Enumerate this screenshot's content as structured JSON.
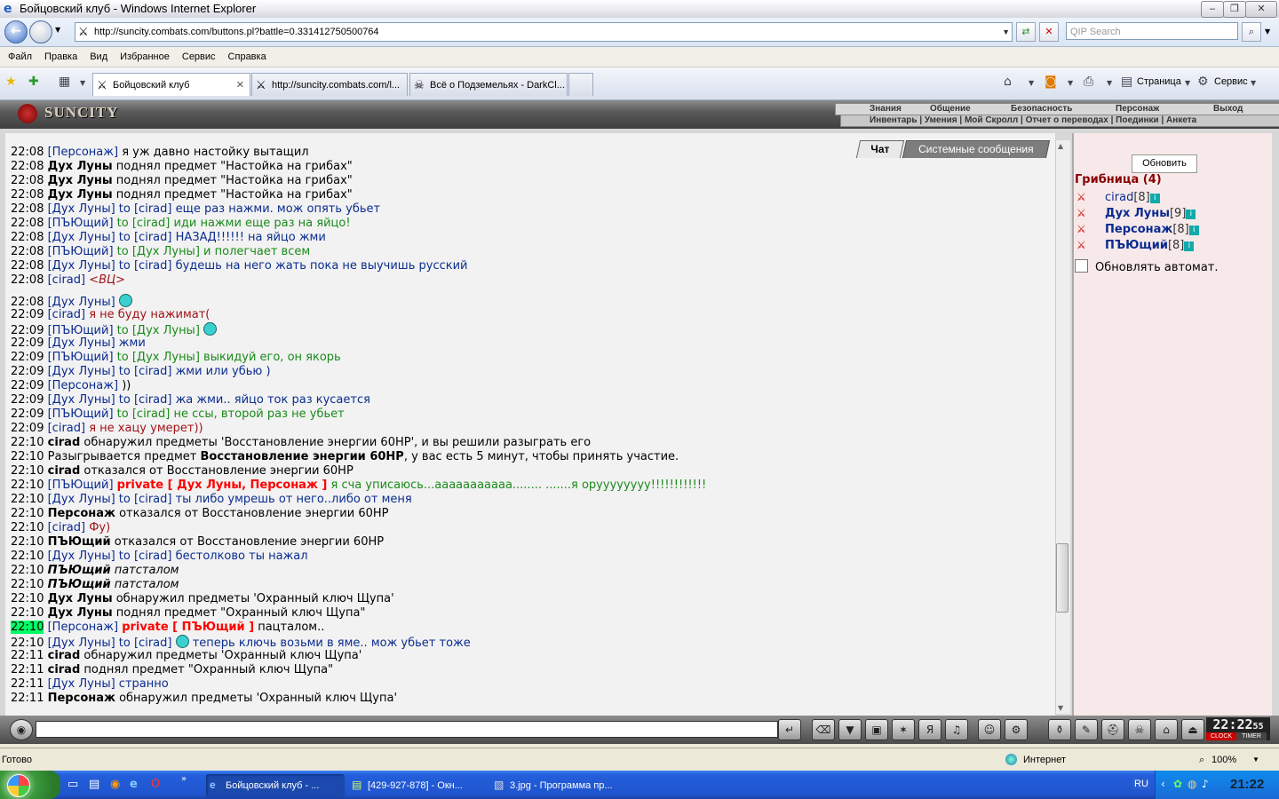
{
  "window": {
    "title": "Бойцовский клуб - Windows Internet Explorer",
    "url": "http://suncity.combats.com/buttons.pl?battle=0.331412750500764",
    "search_placeholder": "QIP Search"
  },
  "menu": [
    "Файл",
    "Правка",
    "Вид",
    "Избранное",
    "Сервис",
    "Справка"
  ],
  "tabs": [
    {
      "label": "Бойцовский клуб",
      "close": "✕"
    },
    {
      "label": "http://suncity.combats.com/l..."
    },
    {
      "label": "Всё о Подземельях - DarkCl..."
    }
  ],
  "toolbar": {
    "page_label": "Страница",
    "tools_label": "Сервис"
  },
  "game": {
    "logo": "SUNCITY",
    "nav_top": [
      "Знания",
      "Общение",
      "Безопасность",
      "Персонаж",
      "Выход"
    ],
    "nav_bottom": "Инвентарь | Умения | Мой Скролл | Отчет о переводах | Поединки | Анкета",
    "chat_tab": "Чат",
    "system_tab": "Системные сообщения",
    "refresh_btn": "Обновить",
    "location": "Грибница (4)",
    "players": [
      {
        "name": "cirad",
        "level": "[8]",
        "bold": false
      },
      {
        "name": "Дух Луны",
        "level": "[9]",
        "bold": true
      },
      {
        "name": "Персонаж",
        "level": "[8]",
        "bold": true
      },
      {
        "name": "ПЪЮщий",
        "level": "[8]",
        "bold": true
      }
    ],
    "auto_refresh": "Обновлять автомат.",
    "clock": "22:22",
    "clock_sec": "55",
    "clock_label": "CLOCK",
    "timer_label": "TIMER"
  },
  "chat": [
    {
      "t": "22:08",
      "parts": [
        [
          "b",
          "[Персонаж]"
        ],
        [
          "n",
          " я уж давно настойку вытащил"
        ]
      ]
    },
    {
      "t": "22:08",
      "parts": [
        [
          "k",
          "Дух Луны"
        ],
        [
          "n",
          " поднял предмет \"Настойка на грибах\""
        ]
      ]
    },
    {
      "t": "22:08",
      "parts": [
        [
          "k",
          "Дух Луны"
        ],
        [
          "n",
          " поднял предмет \"Настойка на грибах\""
        ]
      ]
    },
    {
      "t": "22:08",
      "parts": [
        [
          "k",
          "Дух Луны"
        ],
        [
          "n",
          " поднял предмет \"Настойка на грибах\""
        ]
      ]
    },
    {
      "t": "22:08",
      "parts": [
        [
          "b",
          "[Дух Луны]"
        ],
        [
          "u",
          " to [cirad] еще раз нажми. мож опять убьет"
        ]
      ]
    },
    {
      "t": "22:08",
      "parts": [
        [
          "b",
          "[ПЪЮщий]"
        ],
        [
          "g",
          " to [cirad] иди нажми еще раз на яйцо!"
        ]
      ]
    },
    {
      "t": "22:08",
      "parts": [
        [
          "b",
          "[Дух Луны]"
        ],
        [
          "u",
          " to [cirad] НАЗАД!!!!!! на яйцо жми"
        ]
      ]
    },
    {
      "t": "22:08",
      "parts": [
        [
          "b",
          "[ПЪЮщий]"
        ],
        [
          "g",
          " to [Дух Луны] и полегчает всем"
        ]
      ]
    },
    {
      "t": "22:08",
      "parts": [
        [
          "b",
          "[Дух Луны]"
        ],
        [
          "u",
          " to [cirad] будешь на него жать пока не выучишь русский"
        ]
      ]
    },
    {
      "t": "22:08",
      "parts": [
        [
          "b",
          "[cirad]"
        ],
        [
          "ri",
          " <ВЦ>"
        ]
      ]
    },
    {
      "t": "22:08",
      "parts": [
        [
          "b",
          "[Дух Луны]"
        ],
        [
          "n",
          " "
        ],
        [
          "emo",
          ""
        ]
      ]
    },
    {
      "t": "22:09",
      "parts": [
        [
          "b",
          "[cirad]"
        ],
        [
          "r",
          " я не буду нажимат("
        ]
      ]
    },
    {
      "t": "22:09",
      "parts": [
        [
          "b",
          "[ПЪЮщий]"
        ],
        [
          "g",
          " to [Дух Луны] "
        ],
        [
          "emo",
          ""
        ]
      ]
    },
    {
      "t": "22:09",
      "parts": [
        [
          "b",
          "[Дух Луны]"
        ],
        [
          "u",
          " жми"
        ]
      ]
    },
    {
      "t": "22:09",
      "parts": [
        [
          "b",
          "[ПЪЮщий]"
        ],
        [
          "g",
          " to [Дух Луны] выкидуй его, он якорь"
        ]
      ]
    },
    {
      "t": "22:09",
      "parts": [
        [
          "b",
          "[Дух Луны]"
        ],
        [
          "u",
          " to [cirad] жми или убью )"
        ]
      ]
    },
    {
      "t": "22:09",
      "parts": [
        [
          "b",
          "[Персонаж]"
        ],
        [
          "n",
          " ))"
        ]
      ]
    },
    {
      "t": "22:09",
      "parts": [
        [
          "b",
          "[Дух Луны]"
        ],
        [
          "u",
          " to [cirad] жа жми.. яйцо ток раз кусается"
        ]
      ]
    },
    {
      "t": "22:09",
      "parts": [
        [
          "b",
          "[ПЪЮщий]"
        ],
        [
          "g",
          " to [cirad] не ссы, второй раз не убьет"
        ]
      ]
    },
    {
      "t": "22:09",
      "parts": [
        [
          "b",
          "[cirad]"
        ],
        [
          "r",
          " я не хацу умерет))"
        ]
      ]
    },
    {
      "t": "22:10",
      "parts": [
        [
          "k",
          "cirad"
        ],
        [
          "n",
          " обнаружил предметы 'Восстановление энергии 60HP', и вы решили разыграть его"
        ]
      ]
    },
    {
      "t": "22:10",
      "parts": [
        [
          "n",
          "Разыгрывается предмет "
        ],
        [
          "k",
          "Восстановление энергии 60HP"
        ],
        [
          "n",
          ", у вас есть 5 минут, чтобы принять участие."
        ]
      ]
    },
    {
      "t": "22:10",
      "parts": [
        [
          "k",
          "cirad"
        ],
        [
          "n",
          " отказался от Восстановление энергии 60HP"
        ]
      ]
    },
    {
      "t": "22:10",
      "parts": [
        [
          "b",
          "[ПЪЮщий]"
        ],
        [
          "n",
          " "
        ],
        [
          "p",
          "private [ Дух Луны, Персонаж ]"
        ],
        [
          "g",
          " я сча уписаюсь...ааааааааааа........ .......я оруууууууу!!!!!!!!!!!!"
        ]
      ]
    },
    {
      "t": "22:10",
      "parts": [
        [
          "b",
          "[Дух Луны]"
        ],
        [
          "u",
          " to [cirad] ты либо умрешь от него..либо от меня"
        ]
      ]
    },
    {
      "t": "22:10",
      "parts": [
        [
          "k",
          "Персонаж"
        ],
        [
          "n",
          " отказался от Восстановление энергии 60HP"
        ]
      ]
    },
    {
      "t": "22:10",
      "parts": [
        [
          "b",
          "[cirad]"
        ],
        [
          "r",
          " Фу)"
        ]
      ]
    },
    {
      "t": "22:10",
      "parts": [
        [
          "k",
          "ПЪЮщий"
        ],
        [
          "n",
          " отказался от Восстановление энергии 60HP"
        ]
      ]
    },
    {
      "t": "22:10",
      "parts": [
        [
          "b",
          "[Дух Луны]"
        ],
        [
          "u",
          " to [cirad] бестолково ты нажал"
        ]
      ]
    },
    {
      "t": "22:10",
      "parts": [
        [
          "ki",
          "ПЪЮщий"
        ],
        [
          "ni",
          " патсталом"
        ]
      ]
    },
    {
      "t": "22:10",
      "parts": [
        [
          "ki",
          "ПЪЮщий"
        ],
        [
          "ni",
          " патсталом"
        ]
      ]
    },
    {
      "t": "22:10",
      "parts": [
        [
          "k",
          "Дух Луны"
        ],
        [
          "n",
          " обнаружил предметы 'Охранный ключ Щупа'"
        ]
      ]
    },
    {
      "t": "22:10",
      "parts": [
        [
          "k",
          "Дух Луны"
        ],
        [
          "n",
          " поднял предмет \"Охранный ключ Щупа\""
        ]
      ]
    },
    {
      "t": "22:10",
      "hl": true,
      "parts": [
        [
          "b",
          "[Персонаж]"
        ],
        [
          "n",
          " "
        ],
        [
          "p",
          "private [ ПЪЮщий ]"
        ],
        [
          "n",
          " пацталом.."
        ]
      ]
    },
    {
      "t": "22:10",
      "parts": [
        [
          "b",
          "[Дух Луны]"
        ],
        [
          "u",
          " to [cirad] "
        ],
        [
          "emo",
          ""
        ],
        [
          "u",
          " теперь ключь возьми в яме.. мож убьет тоже"
        ]
      ]
    },
    {
      "t": "22:11",
      "parts": [
        [
          "k",
          "cirad"
        ],
        [
          "n",
          " обнаружил предметы 'Охранный ключ Щупа'"
        ]
      ]
    },
    {
      "t": "22:11",
      "parts": [
        [
          "k",
          "cirad"
        ],
        [
          "n",
          " поднял предмет \"Охранный ключ Щупа\""
        ]
      ]
    },
    {
      "t": "22:11",
      "parts": [
        [
          "b",
          "[Дух Луны]"
        ],
        [
          "u",
          " странно"
        ]
      ]
    },
    {
      "t": "22:11",
      "parts": [
        [
          "k",
          "Персонаж"
        ],
        [
          "n",
          " обнаружил предметы 'Охранный ключ Щупа'"
        ]
      ]
    }
  ],
  "status": {
    "left": "Готово",
    "zone": "Интернет",
    "zoom": "100%"
  },
  "taskbar": {
    "items": [
      "Бойцовский клуб - ...",
      "[429-927-878] - Окн...",
      "3.jpg - Программа пр..."
    ],
    "lang": "RU",
    "time": "21:22"
  }
}
